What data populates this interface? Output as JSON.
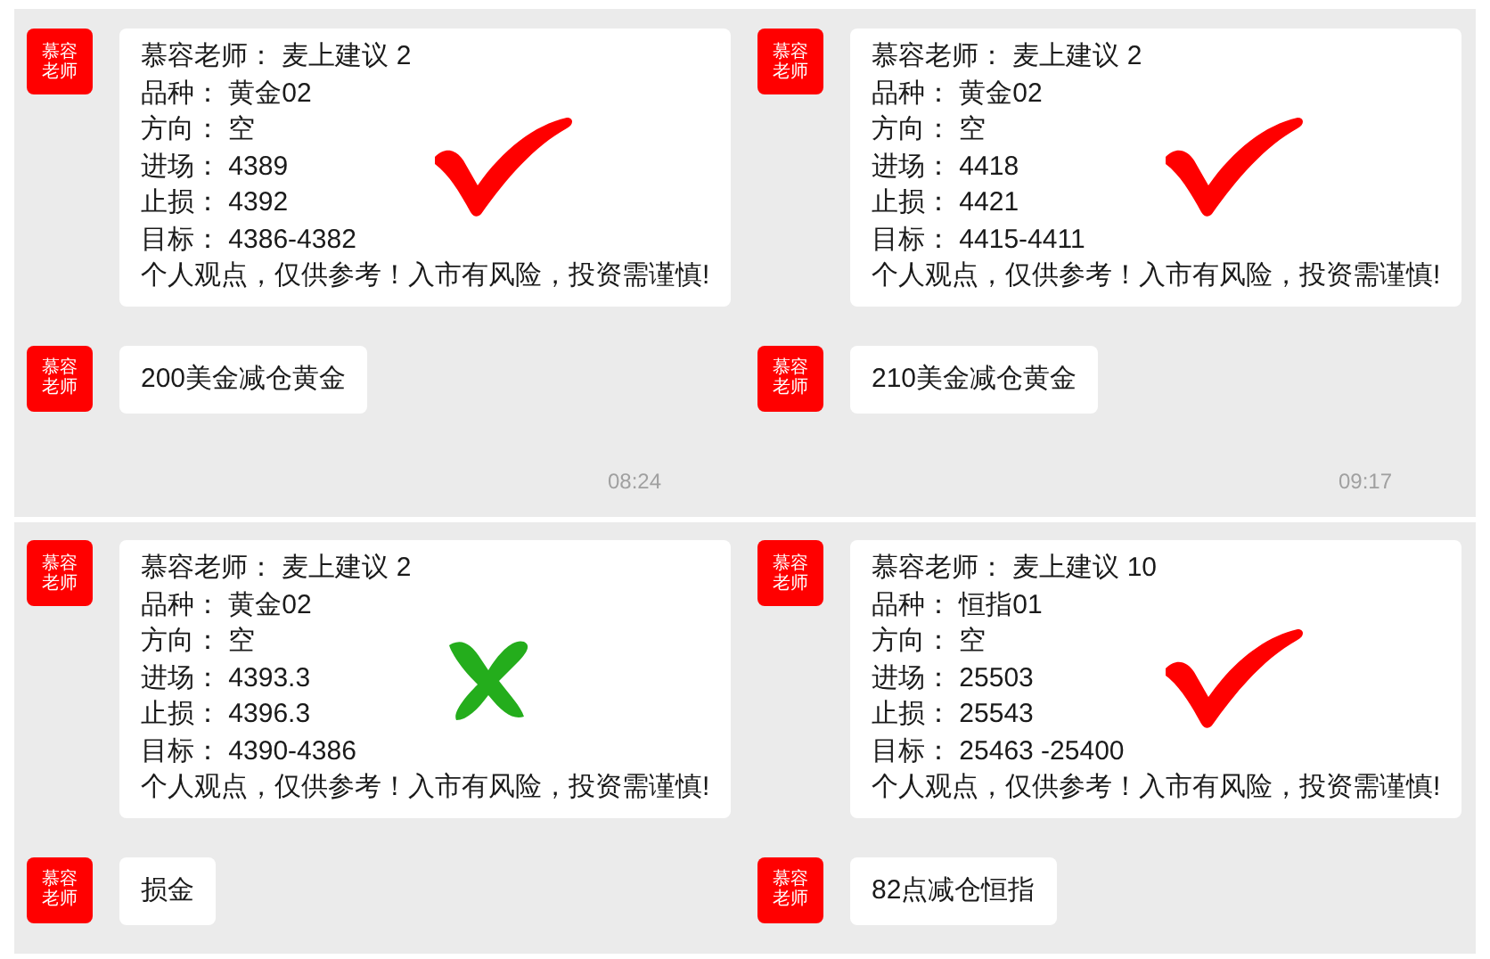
{
  "panels": [
    {
      "kind": "check",
      "avatar": [
        "慕容",
        "老师"
      ],
      "signal": {
        "lines": [
          {
            "label": "慕容老师：",
            "value": "麦上建议 2"
          },
          {
            "label": "品种：",
            "value": "黄金02"
          },
          {
            "label": "方向：",
            "value": "空"
          },
          {
            "label": "进场：",
            "value": "4389"
          },
          {
            "label": "止损：",
            "value": "4392"
          },
          {
            "label": "目标：",
            "value": "4386-4382"
          }
        ],
        "disclaimer": "个人观点，仅供参考！入市有风险，投资需谨慎!"
      },
      "reply": {
        "avatar": [
          "慕容",
          "老师"
        ],
        "text": "200美金减仓黄金"
      },
      "time": "08:24"
    },
    {
      "kind": "check",
      "avatar": [
        "慕容",
        "老师"
      ],
      "signal": {
        "lines": [
          {
            "label": "慕容老师：",
            "value": "麦上建议 2"
          },
          {
            "label": "品种：",
            "value": "黄金02"
          },
          {
            "label": "方向：",
            "value": "空"
          },
          {
            "label": "进场：",
            "value": "4418"
          },
          {
            "label": "止损：",
            "value": "4421"
          },
          {
            "label": "目标：",
            "value": "4415-4411"
          }
        ],
        "disclaimer": "个人观点，仅供参考！入市有风险，投资需谨慎!"
      },
      "reply": {
        "avatar": [
          "慕容",
          "老师"
        ],
        "text": "210美金减仓黄金"
      },
      "time": "09:17"
    },
    {
      "kind": "cross",
      "avatar": [
        "慕容",
        "老师"
      ],
      "signal": {
        "lines": [
          {
            "label": "慕容老师：",
            "value": "麦上建议 2"
          },
          {
            "label": "品种：",
            "value": "黄金02"
          },
          {
            "label": "方向：",
            "value": "空"
          },
          {
            "label": "进场：",
            "value": "4393.3"
          },
          {
            "label": "止损：",
            "value": "4396.3"
          },
          {
            "label": "目标：",
            "value": "4390-4386"
          }
        ],
        "disclaimer": "个人观点，仅供参考！入市有风险，投资需谨慎!"
      },
      "reply": {
        "avatar": [
          "慕容",
          "老师"
        ],
        "text": "损金"
      }
    },
    {
      "kind": "check",
      "avatar": [
        "慕容",
        "老师"
      ],
      "signal": {
        "lines": [
          {
            "label": "慕容老师：",
            "value": "麦上建议 10"
          },
          {
            "label": "品种：",
            "value": "恒指01"
          },
          {
            "label": "方向：",
            "value": "空"
          },
          {
            "label": "进场：",
            "value": "25503"
          },
          {
            "label": "止损：",
            "value": "25543"
          },
          {
            "label": "目标：",
            "value": "25463 -25400"
          }
        ],
        "disclaimer": "个人观点，仅供参考！入市有风险，投资需谨慎!"
      },
      "reply": {
        "avatar": [
          "慕容",
          "老师"
        ],
        "text": "82点减仓恒指"
      }
    }
  ]
}
